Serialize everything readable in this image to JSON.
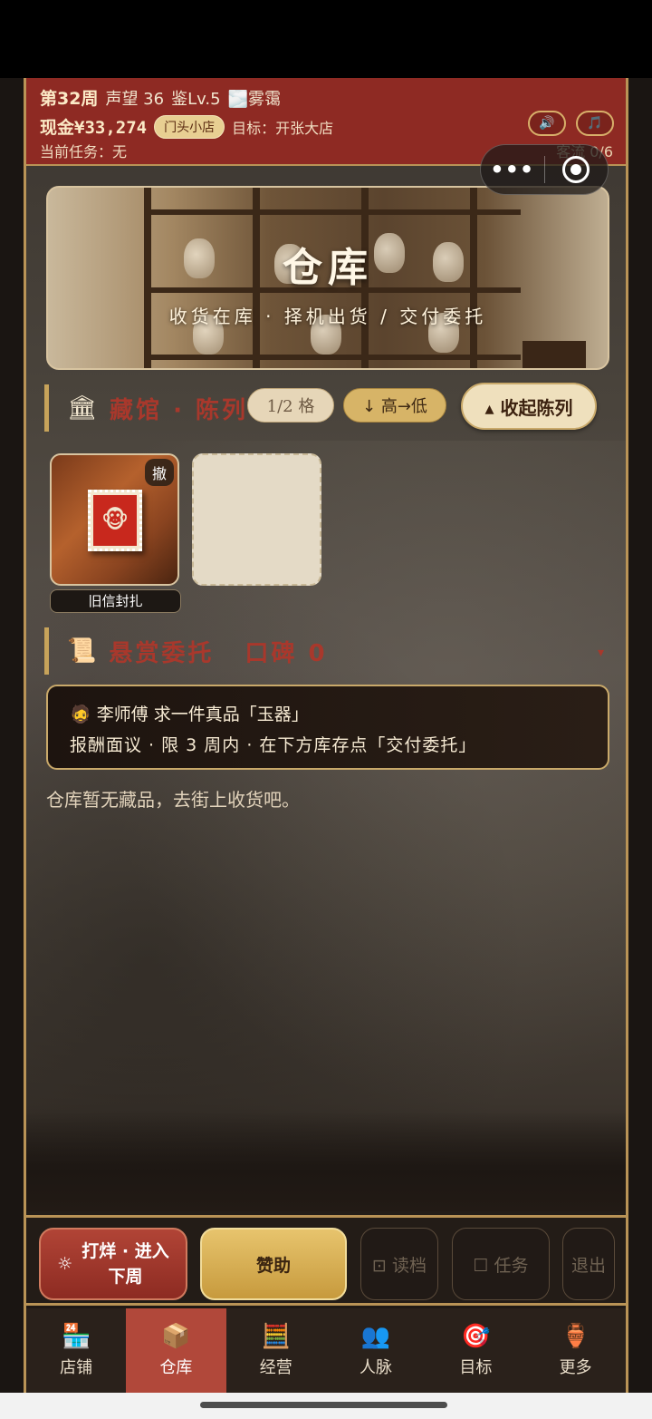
{
  "header": {
    "week": "第32周",
    "reputation": "声望 36",
    "appraise": "鉴Lv.5",
    "weather": "🌫️雾霭",
    "cash": "现金¥33,274",
    "shop_tier": "门头小店",
    "target": "目标：开张大店",
    "current_task": "当前任务：无",
    "sound_icon": "🔊",
    "music_icon": "🎵",
    "traffic": "客流 0/6"
  },
  "capsule": {
    "more": "•••"
  },
  "banner": {
    "title": "仓库",
    "subtitle": "收货在库 · 择机出货 / 交付委托"
  },
  "display_section": {
    "title": "藏馆 · 陈列",
    "icon": "🏛",
    "capacity": "1/2 格",
    "sort": "↓ 高→低",
    "collapse": "▴ 收起陈列"
  },
  "display_items": [
    {
      "name": "旧信封扎",
      "withdraw": "撤",
      "icon": "🐵"
    }
  ],
  "commission_section": {
    "icon": "📜",
    "title": "悬赏委托",
    "reputation": "口碑 0",
    "chevron": "▾"
  },
  "commission": {
    "line1": "🧔 李师傅 求一件真品「玉器」",
    "line2": "报酬面议  ·  限 3 周内  ·  在下方库存点「交付委托」"
  },
  "empty_note": "仓库暂无藏品，去街上收货吧。",
  "actions": {
    "close_week_icon": "☼",
    "close_week": "打烊 · 进入\n下周",
    "sponsor": "赞助",
    "load": "⊡ 读档",
    "task": "☐ 任务",
    "exit": "退出"
  },
  "tabs": [
    {
      "label": "店铺",
      "icon": "🏪",
      "active": false
    },
    {
      "label": "仓库",
      "icon": "📦",
      "active": true
    },
    {
      "label": "经营",
      "icon": "🧮",
      "active": false
    },
    {
      "label": "人脉",
      "icon": "👥",
      "active": false
    },
    {
      "label": "目标",
      "icon": "🎯",
      "active": false
    },
    {
      "label": "更多",
      "icon": "🏺",
      "active": false
    }
  ]
}
